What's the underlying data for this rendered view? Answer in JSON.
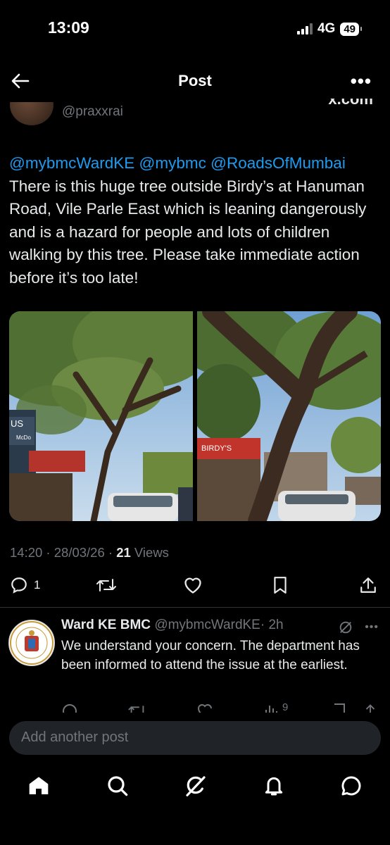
{
  "status_bar": {
    "time": "13:09",
    "network": "4G",
    "battery": "49"
  },
  "nav": {
    "title": "Post"
  },
  "tweet": {
    "handle": "@praxxrai",
    "cut_off_text": "x.com",
    "mentions": [
      "@mybmcWardKE",
      "@mybmc",
      "@RoadsOfMumbai"
    ],
    "body": "There is this huge tree outside Birdy’s at Hanuman Road, Vile Parle East which is leaning dangerously and is a hazard for people and lots of children walking by this tree. Please take immediate action before it’s too late!",
    "timestamp": "14:20 · 28/03/26 · ",
    "views_count": "21",
    "views_label": " Views",
    "reply_count": "1"
  },
  "photos": [
    {
      "icon": "street-tree-photo",
      "sign_text": "US",
      "sign_text_2": "McDo"
    },
    {
      "icon": "leaning-tree-photo",
      "sign_text": "BIRDY'S"
    }
  ],
  "reply": {
    "name": "Ward KE BMC",
    "handle": "@mybmcWardKE",
    "time": "· 2h",
    "text": "We understand your concern. The department has been informed to attend the issue at the earliest.",
    "views": "9"
  },
  "composer": {
    "placeholder": "Add another post"
  },
  "colors": {
    "accent": "#1d9bf0",
    "muted": "#71767b",
    "text": "#e7e9ea",
    "background": "#000000",
    "composer": "#202327"
  }
}
